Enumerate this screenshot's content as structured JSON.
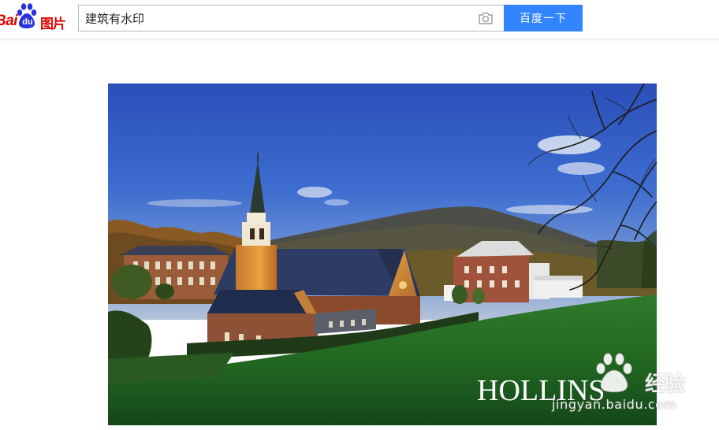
{
  "header": {
    "logo": {
      "brand_text": "Bai",
      "paw_text": "du",
      "product_text": "图片"
    },
    "search": {
      "query": "建筑有水印",
      "camera_icon": "camera-icon",
      "button_label": "百度一下"
    }
  },
  "main": {
    "photo": {
      "subject": "Hollins University campus chapel at sunset",
      "overlay_text": "HOLLINS"
    }
  },
  "watermark": {
    "brand": "经验",
    "domain": "jingyan.baidu.com"
  },
  "colors": {
    "brand_red": "#e10602",
    "paw_blue": "#2932e1",
    "button_blue": "#3385ff"
  }
}
